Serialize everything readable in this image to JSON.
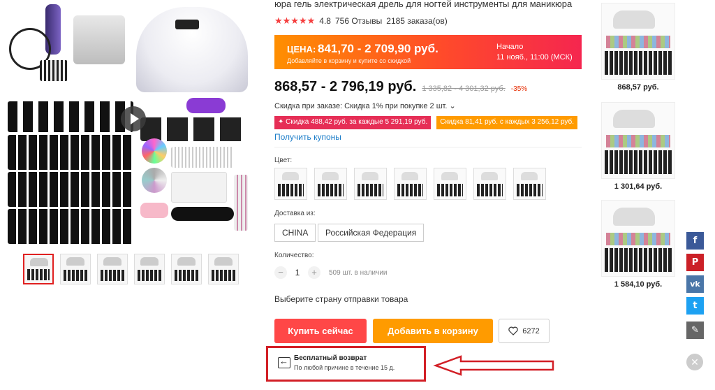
{
  "product": {
    "title": "юра гель электрическая дрель для ногтей инструменты для маникюра",
    "stars": "★★★★★",
    "rating": "4.8",
    "reviews": "756 Отзывы",
    "orders": "2185 заказа(ов)"
  },
  "promo": {
    "label": "ЦЕНА:",
    "price": "841,70 - 2 709,90 руб.",
    "subtitle": "Добавляйте в корзину и купите со скидкой",
    "start_label": "Начало",
    "start_date": "11 нояб., 11:00 (МСК)"
  },
  "price": {
    "current": "868,57 - 2 796,19 руб.",
    "old": "1 335,82 - 4 301,32 руб.",
    "discount": "-35%"
  },
  "order_discount": "Скидка при заказе: Скидка 1% при покупке 2 шт. ⌄",
  "coupons_chips": [
    "✦ Скидка 488,42 руб. за каждые 5 291,19 руб.",
    "Скидка 81,41 руб. с каждых 3 256,12 руб."
  ],
  "get_coupons": "Получить купоны",
  "color_label": "Цвет:",
  "ship_from_label": "Доставка из:",
  "ship_from": [
    "CHINA",
    "Российская Федерация"
  ],
  "quantity_label": "Количество:",
  "quantity": {
    "minus": "−",
    "value": "1",
    "plus": "+",
    "available": "509 шт. в наличии"
  },
  "choose_country": "Выберите страну отправки товара",
  "buttons": {
    "buy_now": "Купить сейчас",
    "add_to_cart": "Добавить в корзину",
    "wishlist_count": "6272"
  },
  "free_return": {
    "title": "Бесплатный возврат",
    "subtitle": "По любой причине в течение 15 д."
  },
  "recommendations": [
    {
      "price": "868,57 руб."
    },
    {
      "price": "1 301,64 руб."
    },
    {
      "price": "1 584,10 руб."
    }
  ],
  "social": {
    "facebook": "f",
    "pinterest": "P",
    "vk": "vk",
    "twitter": "t",
    "edit": "✎",
    "close": "✕"
  },
  "colors": {
    "accent_red": "#ff4747",
    "accent_orange": "#ff9b00",
    "link_blue": "#1a7cc8",
    "annotation_red": "#d21f26"
  }
}
